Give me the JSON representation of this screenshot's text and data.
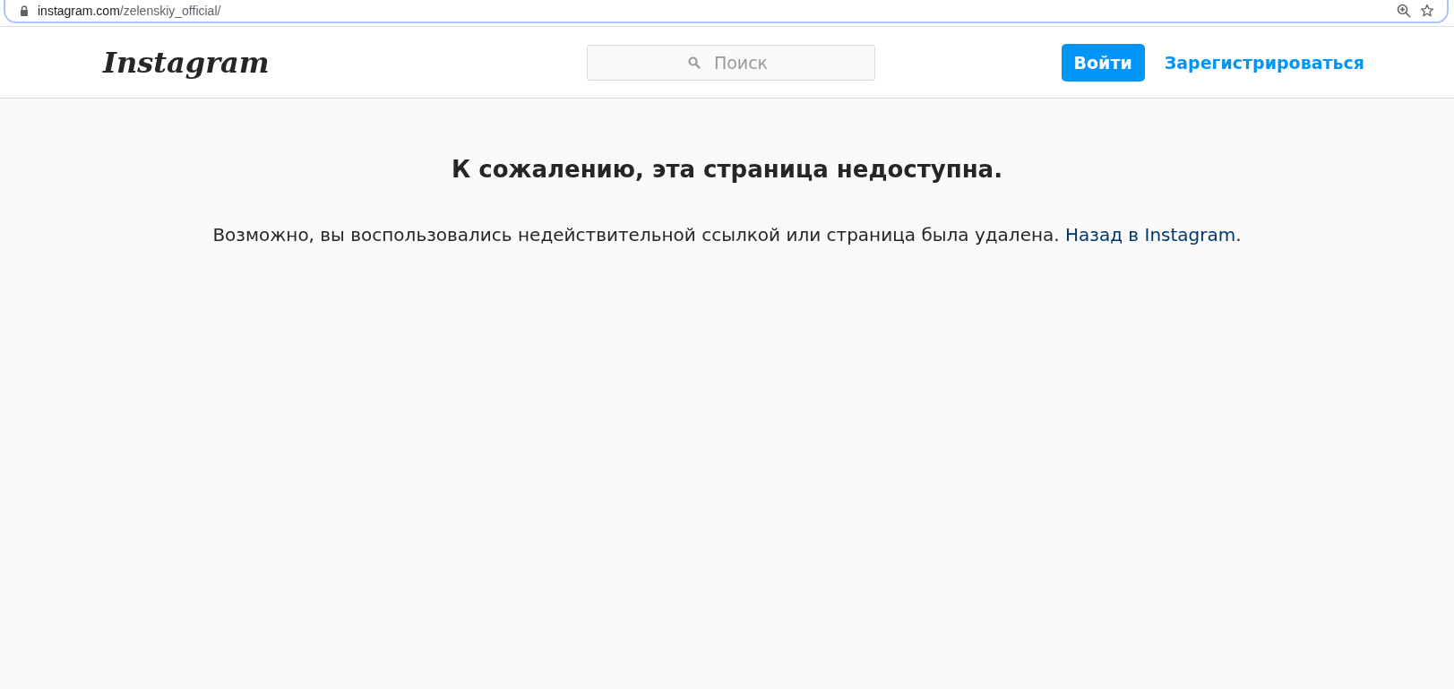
{
  "browser": {
    "url_host": "instagram.com",
    "url_path": "/zelenskiy_official/"
  },
  "header": {
    "logo": "Instagram",
    "search": {
      "placeholder": "Поиск"
    },
    "login_button": "Войти",
    "signup_link": "Зарегистрироваться"
  },
  "error": {
    "title": "К сожалению, эта страница недоступна.",
    "message": "Возможно, вы воспользовались недействительной ссылкой или страница была удалена. ",
    "link": "Назад в Instagram",
    "message_end": "."
  }
}
